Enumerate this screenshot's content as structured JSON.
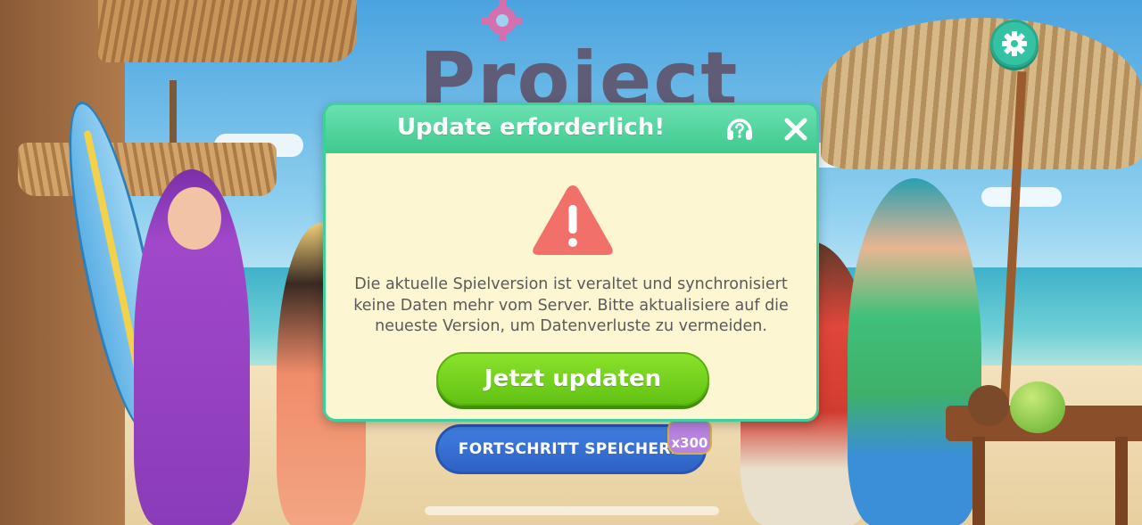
{
  "game": {
    "logo_text": "Project"
  },
  "dialog": {
    "title": "Update erforderlich!",
    "message": "Die aktuelle Spielversion ist veraltet und synchronisiert keine Daten mehr vom Server. Bitte aktualisiere auf die neueste Version, um Datenverluste zu vermeiden.",
    "update_button": "Jetzt updaten",
    "help_icon": "headset-question-icon",
    "close_icon": "close-icon",
    "warning_icon": "warning-triangle-icon"
  },
  "background": {
    "save_button": "FORTSCHRITT SPEICHERN",
    "reward_badge": "x300"
  },
  "settings": {
    "icon": "gear-icon"
  },
  "colors": {
    "header_green": "#3fc98f",
    "dialog_bg": "#fdf6d3",
    "update_green": "#6ccc18",
    "warning_red": "#f2706a",
    "settings_teal": "#33c3a3",
    "save_blue": "#2f62c4"
  }
}
